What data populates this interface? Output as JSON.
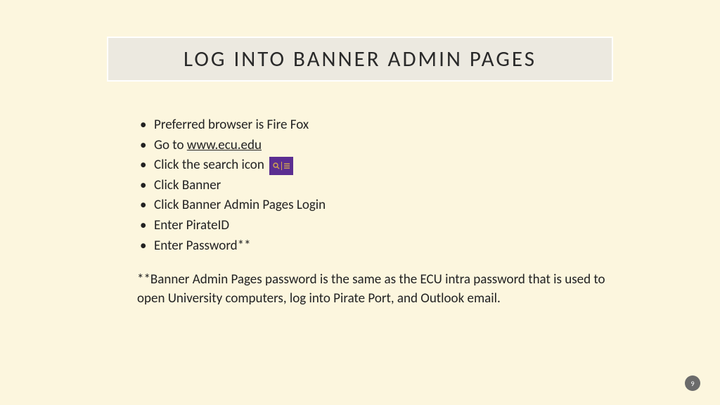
{
  "title": "LOG INTO BANNER ADMIN PAGES",
  "bullets": {
    "b1": "Preferred browser is Fire Fox",
    "b2_prefix": "Go to ",
    "b2_link": "www.ecu.edu",
    "b3": "Click the search icon",
    "b4": "Click Banner",
    "b5": "Click Banner Admin Pages Login",
    "b6": "Enter PirateID",
    "b7": "Enter Password**"
  },
  "footnote": "**Banner Admin Pages password is the same as the ECU intra password that is used to open University computers, log into Pirate Port, and Outlook email.",
  "page_number": "9"
}
